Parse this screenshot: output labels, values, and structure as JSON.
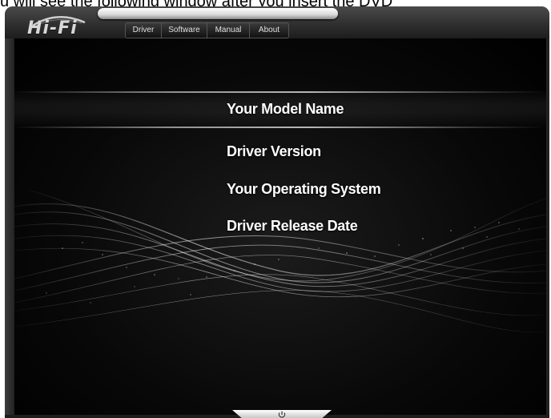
{
  "document": {
    "caption": "u will see the following window after you insert the DVD"
  },
  "app": {
    "logo_text": "Hi-Fi"
  },
  "nav": {
    "items": [
      {
        "label": "Driver"
      },
      {
        "label": "Software"
      },
      {
        "label": "Manual"
      },
      {
        "label": "About"
      }
    ]
  },
  "info": {
    "model_name": "Your Model Name",
    "driver_version": "Driver Version",
    "operating_system": "Your Operating System",
    "release_date": "Driver Release Date"
  },
  "icons": {
    "power": "power-icon"
  },
  "colors": {
    "background": "#000000",
    "text": "#ffffff",
    "frame": "#2a2a2a"
  }
}
